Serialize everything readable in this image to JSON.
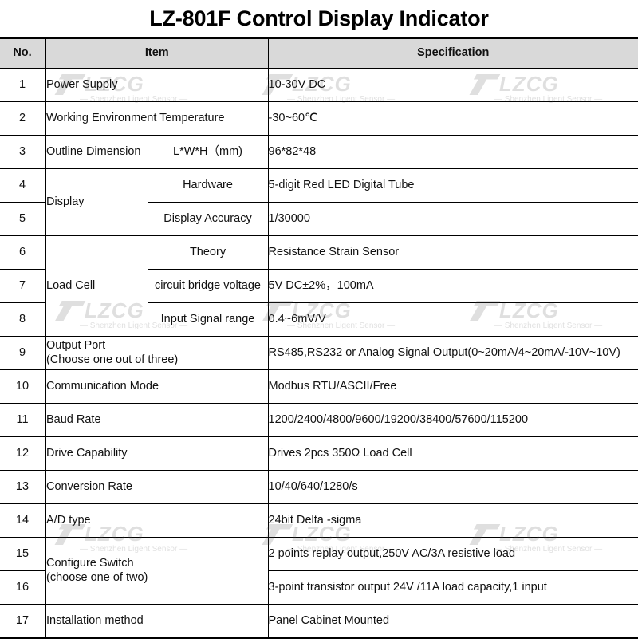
{
  "title": "LZ-801F Control Display Indicator",
  "headers": {
    "no": "No.",
    "item": "Item",
    "spec": "Specification"
  },
  "rows": [
    {
      "no": "1",
      "item": "Power Supply",
      "spec": "10-30V DC"
    },
    {
      "no": "2",
      "item": "Working Environment Temperature",
      "spec": "-30~60℃"
    },
    {
      "no": "3",
      "item": "Outline Dimension",
      "sub": "L*W*H（mm)",
      "spec": "96*82*48"
    },
    {
      "no": "4",
      "item": "Display",
      "sub": "Hardware",
      "spec": "5-digit Red LED Digital Tube"
    },
    {
      "no": "5",
      "sub": "Display Accuracy",
      "spec": "1/30000"
    },
    {
      "no": "6",
      "item": "Load Cell",
      "sub": "Theory",
      "spec": "Resistance Strain Sensor"
    },
    {
      "no": "7",
      "sub": "circuit bridge voltage",
      "spec": "5V DC±2%，100mA"
    },
    {
      "no": "8",
      "sub": "Input Signal range",
      "spec": "0.4~6mV/V"
    },
    {
      "no": "9",
      "item": "Output Port",
      "item_note": "(Choose one out of three)",
      "spec": "RS485,RS232 or Analog Signal Output(0~20mA/4~20mA/-10V~10V)"
    },
    {
      "no": "10",
      "item": "Communication Mode",
      "spec": "Modbus RTU/ASCII/Free"
    },
    {
      "no": "11",
      "item": "Baud Rate",
      "spec": "1200/2400/4800/9600/19200/38400/57600/115200"
    },
    {
      "no": "12",
      "item": "Drive Capability",
      "spec": "Drives 2pcs 350Ω Load Cell"
    },
    {
      "no": "13",
      "item": "Conversion Rate",
      "spec": "10/40/640/1280/s"
    },
    {
      "no": "14",
      "item": "A/D type",
      "spec": "24bit Delta -sigma"
    },
    {
      "no": "15",
      "item": "Configure Switch",
      "item_note": "(choose one of two)",
      "spec": "2 points replay output,250V  AC/3A resistive load"
    },
    {
      "no": "16",
      "spec": "3-point transistor output 24V /11A load capacity,1 input"
    },
    {
      "no": "17",
      "item": "Installation method",
      "spec": "Panel Cabinet Mounted"
    }
  ],
  "watermark": {
    "brand": "LZCG",
    "tagline": "— Shenzhen Ligent Sensor —"
  }
}
